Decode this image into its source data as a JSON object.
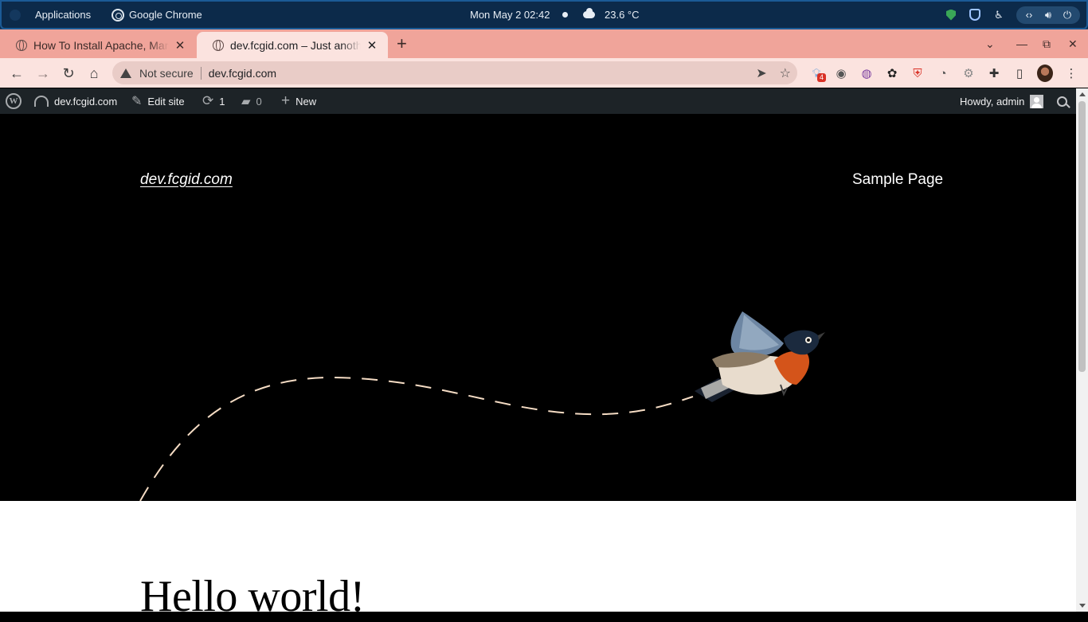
{
  "system_panel": {
    "applications_label": "Applications",
    "active_app_label": "Google Chrome",
    "clock": "Mon May 2  02:42",
    "weather": "23.6 °C"
  },
  "browser": {
    "tabs": [
      {
        "title": "How To Install Apache, MariaDB,",
        "active": false
      },
      {
        "title": "dev.fcgid.com – Just another",
        "active": true
      }
    ],
    "security_label": "Not secure",
    "url": "dev.fcgid.com",
    "extension_badge": "4",
    "accent_color": "#f0a49a"
  },
  "admin_bar": {
    "site_name": "dev.fcgid.com",
    "edit_site_label": "Edit site",
    "updates_count": "1",
    "comments_count": "0",
    "new_label": "New",
    "greeting": "Howdy, admin"
  },
  "site": {
    "title": "dev.fcgid.com",
    "nav_items": [
      "Sample Page"
    ],
    "post_title": "Hello world!"
  }
}
